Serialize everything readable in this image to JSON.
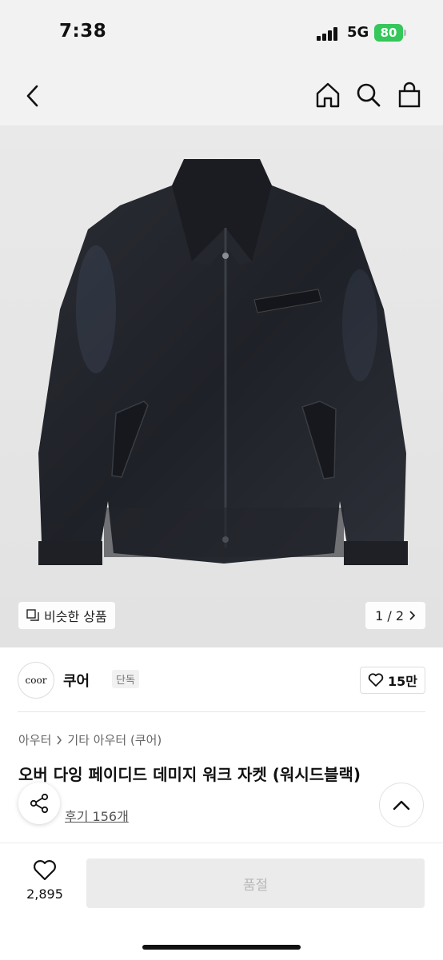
{
  "status_bar": {
    "time": "7:38",
    "network": "5G",
    "battery": "80"
  },
  "product": {
    "similar_label": "비슷한 상품",
    "pager": "1 / 2",
    "brand": {
      "logo_text": "coor",
      "name": "쿠어",
      "tag": "단독"
    },
    "likes": "15만",
    "breadcrumb": [
      "아우터",
      "기타 아우터 (쿠어)"
    ],
    "title": "오버 다잉 페이디드 데미지 워크 자켓 (워시드블랙)",
    "reviews": "후기 156개"
  },
  "bottom_bar": {
    "wish_count": "2,895",
    "soldout_label": "품절"
  },
  "colors": {
    "soldout_bg": "#ebebeb",
    "battery": "#34c759"
  }
}
